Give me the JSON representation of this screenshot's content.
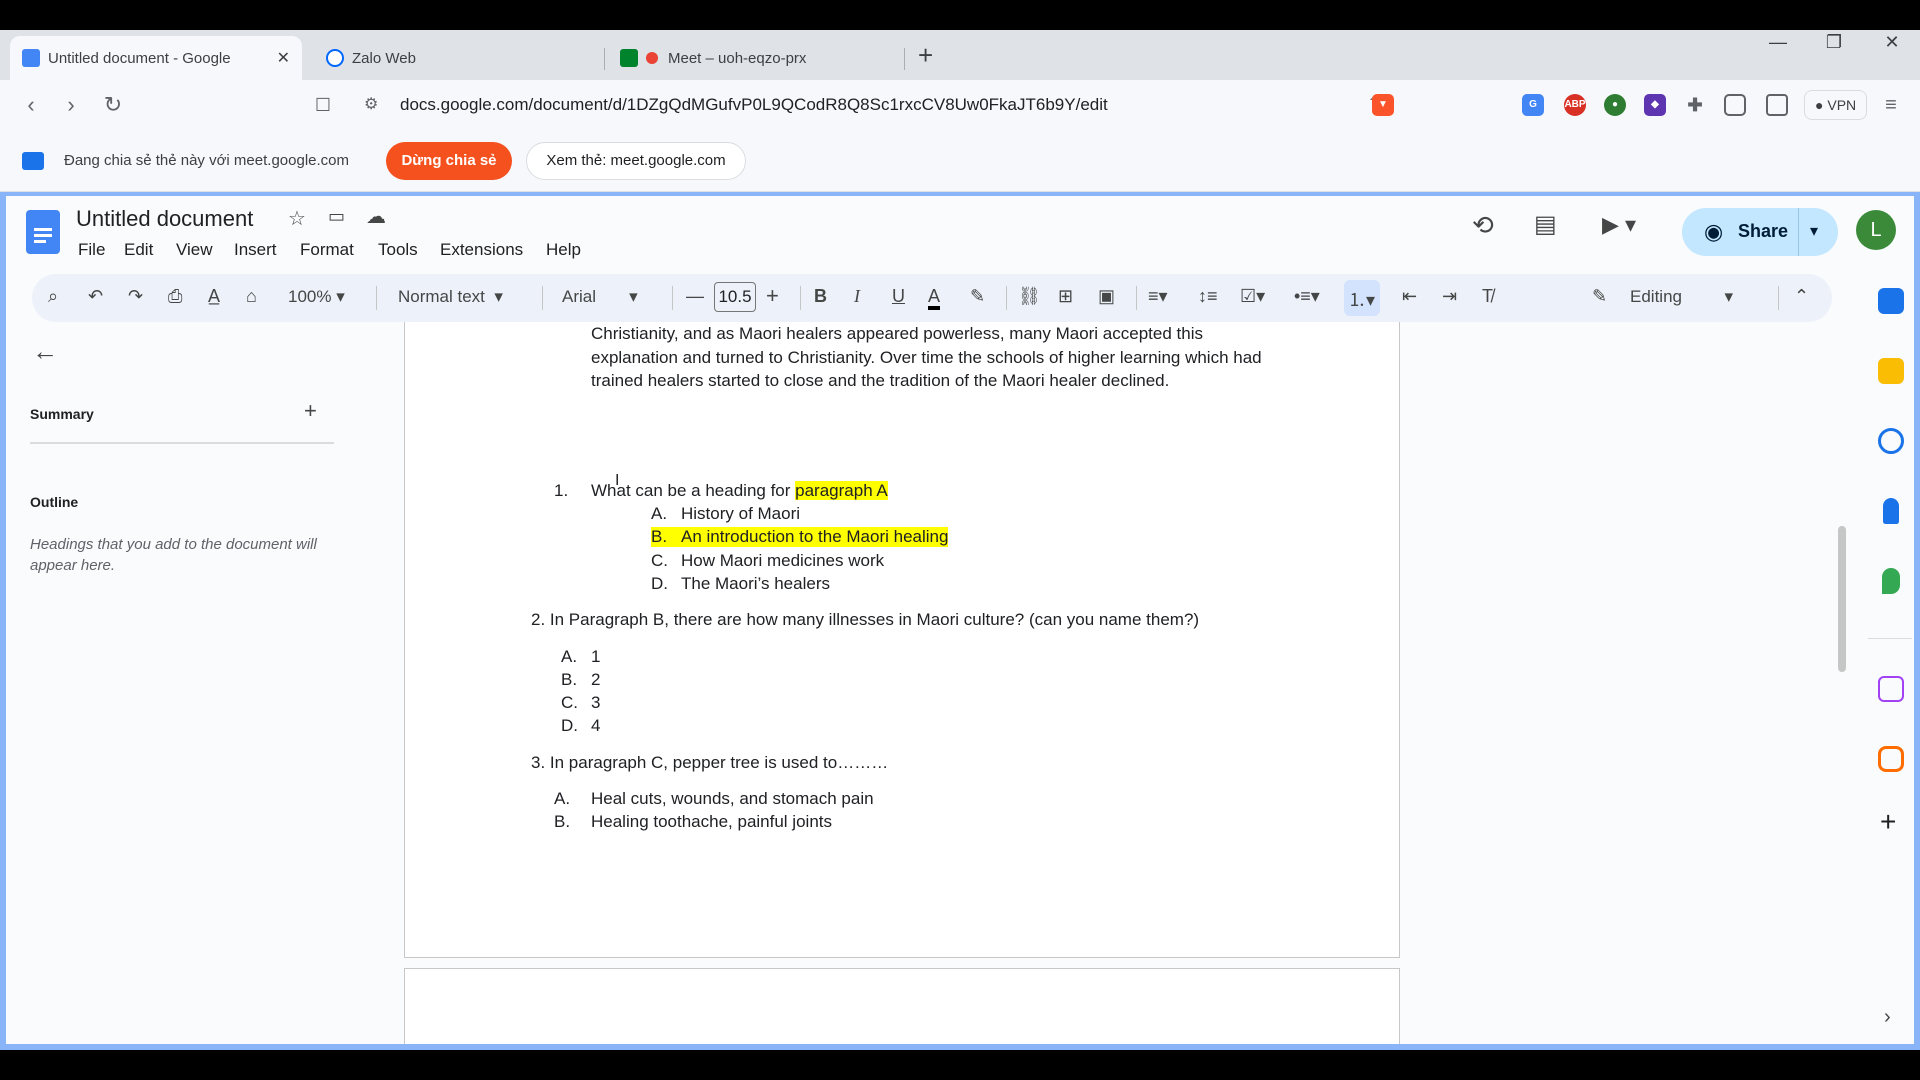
{
  "browser": {
    "tabs": [
      {
        "title": "Untitled document - Google",
        "active": true
      },
      {
        "title": "Zalo Web",
        "active": false
      },
      {
        "title": "Meet – uoh-eqzo-prx",
        "active": false
      }
    ],
    "new_tab_icon": "plus-icon",
    "url": "docs.google.com/document/d/1DZgQdMGufvP0L9QCodR8Q8Sc1rxcCV8Uw0FkaJT6b9Y/edit",
    "vpn_label": "VPN",
    "extensions": [
      "google-translate-icon",
      "adblock-icon",
      "ext-green-icon",
      "ext-purple-icon",
      "puzzle-icon"
    ]
  },
  "share_bar": {
    "message": "Đang chia sẻ thẻ này với meet.google.com",
    "stop_label": "Dừng chia sẻ",
    "view_label": "Xem thẻ: meet.google.com"
  },
  "docs": {
    "title": "Untitled document",
    "menu": [
      "File",
      "Edit",
      "View",
      "Insert",
      "Format",
      "Tools",
      "Extensions",
      "Help"
    ],
    "share_label": "Share",
    "avatar_initial": "L",
    "toolbar": {
      "zoom": "100%",
      "style": "Normal text",
      "font": "Arial",
      "font_size": "10.5",
      "mode": "Editing"
    },
    "sidebar": {
      "summary_label": "Summary",
      "outline_label": "Outline",
      "outline_note": "Headings that you add to the document will appear here."
    },
    "content": {
      "para_lines": [
        "Christianity, and as Maori healers appeared powerless, many Maori accepted this",
        "explanation and turned to Christianity. Over time the schools of higher learning which had",
        "trained healers started to close and the tradition of the Maori healer declined."
      ],
      "q1": {
        "number": "1.",
        "text": "What can be a heading for ",
        "highlight": "paragraph A",
        "options": [
          {
            "letter": "A.",
            "text": "History of Maori"
          },
          {
            "letter": "B.",
            "text": "An introduction to the Maori healing"
          },
          {
            "letter": "C.",
            "text": "How Maori medicines work"
          },
          {
            "letter": "D.",
            "text": "The Maori’s healers"
          }
        ]
      },
      "q2": {
        "text": "2. In Paragraph B, there are how many illnesses in Maori culture? (can you name them?)",
        "options": [
          {
            "letter": "A.",
            "text": "1"
          },
          {
            "letter": "B.",
            "text": "2"
          },
          {
            "letter": "C.",
            "text": "3"
          },
          {
            "letter": "D.",
            "text": "4"
          }
        ]
      },
      "q3": {
        "text": "3. In paragraph C, pepper tree is used to………",
        "options": [
          {
            "letter": "A.",
            "text": "Heal cuts, wounds, and stomach pain"
          },
          {
            "letter": "B.",
            "text": "Healing toothache, painful joints"
          }
        ]
      }
    }
  },
  "colors": {
    "accent": "#c2e7ff",
    "stop_share": "#f4511e",
    "highlight": "#ffff00",
    "frame": "#8ab4f8"
  }
}
